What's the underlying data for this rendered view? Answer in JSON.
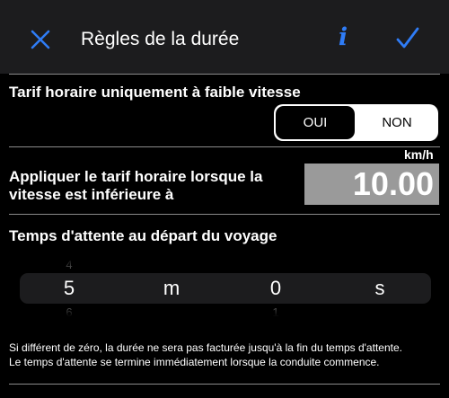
{
  "header": {
    "title": "Règles de la durée",
    "close_icon": "close-x-icon",
    "info_icon": "info-i-icon",
    "info_glyph": "i",
    "confirm_icon": "checkmark-icon",
    "accent_color": "#2f7cf6",
    "background_color": "#1c1c1e"
  },
  "tariff_section": {
    "label": "Tarif horaire uniquement à faible vitesse",
    "options": [
      "OUI",
      "NON"
    ],
    "selected": "OUI"
  },
  "speed_section": {
    "label_line1": "Appliquer le tarif horaire lorsque la",
    "label_line2": "vitesse est inférieure à",
    "unit": "km/h",
    "value": "10.00"
  },
  "wait_section": {
    "label": "Temps d'attente au départ du voyage",
    "picker": {
      "minutes_prev": "4",
      "minutes": "5",
      "minutes_next": "6",
      "minutes_unit": "m",
      "seconds": "0",
      "seconds_next": "1",
      "seconds_unit": "s"
    },
    "footnote_line1": "Si différent de zéro, la durée ne sera pas facturée jusqu'à la fin du temps d'attente.",
    "footnote_line2": "Le temps d'attente se termine immédiatement lorsque la conduite commence."
  }
}
